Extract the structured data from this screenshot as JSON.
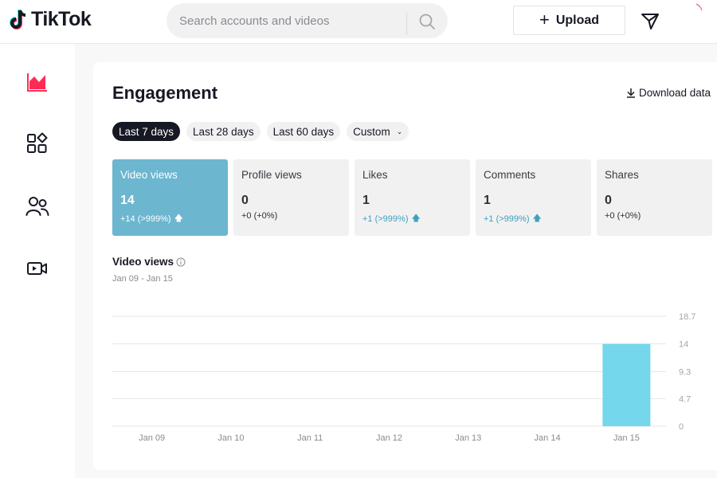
{
  "app": {
    "logo_text": "TikTok"
  },
  "header": {
    "search": {
      "placeholder": "Search accounts and videos",
      "value": ""
    },
    "upload_label": "Upload",
    "icons": [
      "search-icon",
      "plus-icon",
      "inbox-icon"
    ]
  },
  "sidebar": {
    "items": [
      {
        "icon": "analytics-chart-icon",
        "active": true,
        "color": "#fe2c55"
      },
      {
        "icon": "content-grid-icon",
        "active": false
      },
      {
        "icon": "followers-icon",
        "active": false
      },
      {
        "icon": "live-video-icon",
        "active": false
      }
    ]
  },
  "engagement": {
    "title": "Engagement",
    "download_label": "Download data",
    "filters": [
      {
        "label": "Last 7 days",
        "active": true
      },
      {
        "label": "Last 28 days",
        "active": false
      },
      {
        "label": "Last 60 days",
        "active": false
      },
      {
        "label": "Custom",
        "active": false,
        "dropdown": true
      }
    ],
    "metrics": [
      {
        "label": "Video views",
        "value": "14",
        "change": "+14 (>999%)",
        "trend": "up",
        "active": true
      },
      {
        "label": "Profile views",
        "value": "0",
        "change": "+0 (+0%)",
        "trend": "flat",
        "active": false
      },
      {
        "label": "Likes",
        "value": "1",
        "change": "+1 (>999%)",
        "trend": "up",
        "active": false
      },
      {
        "label": "Comments",
        "value": "1",
        "change": "+1 (>999%)",
        "trend": "up",
        "active": false
      },
      {
        "label": "Shares",
        "value": "0",
        "change": "+0 (+0%)",
        "trend": "flat",
        "active": false
      }
    ],
    "chart_title": "Video views",
    "chart_range": "Jan 09 - Jan 15"
  },
  "colors": {
    "brand": "#fe2c55",
    "active_metric": "#6cb6cf",
    "bar": "#74d7ec",
    "trend_up": "#3fa0be"
  },
  "chart_data": {
    "type": "bar",
    "title": "Video views",
    "subtitle": "Jan 09 - Jan 15",
    "categories": [
      "Jan 09",
      "Jan 10",
      "Jan 11",
      "Jan 12",
      "Jan 13",
      "Jan 14",
      "Jan 15"
    ],
    "values": [
      0,
      0,
      0,
      0,
      0,
      0,
      14
    ],
    "yticks": [
      "0",
      "4.7",
      "9.3",
      "14",
      "18.7"
    ],
    "ytick_values": [
      0,
      4.7,
      9.3,
      14,
      18.7
    ],
    "ylim": [
      0,
      18.7
    ],
    "y_axis_side": "right",
    "grid": true,
    "xlabel": "",
    "ylabel": ""
  }
}
